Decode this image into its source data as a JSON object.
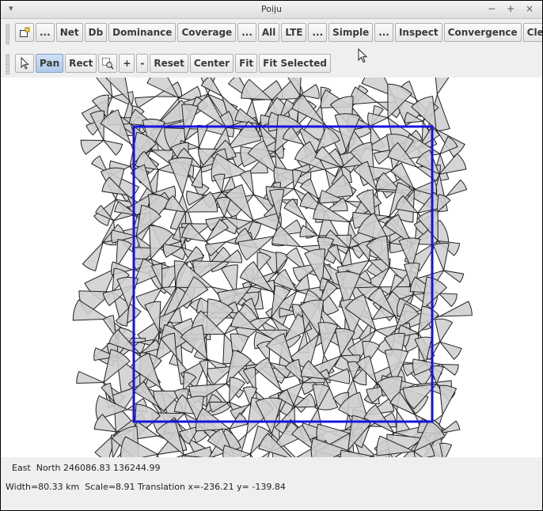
{
  "window": {
    "title": "Poiju",
    "controls": "− + ×"
  },
  "toolbar1": {
    "buttons": [
      "...",
      "Net",
      "Db",
      "Dominance",
      "Coverage",
      "...",
      "All",
      "LTE",
      "...",
      "Simple",
      "...",
      "Inspect",
      "Convergence",
      "Cle"
    ]
  },
  "toolbar2": {
    "buttons": [
      "Pan",
      "Rect",
      "+",
      "-",
      "Reset",
      "Center",
      "Fit",
      "Fit Selected"
    ],
    "selected": "Pan"
  },
  "status": {
    "line1": "East  North 246086.83 136244.99",
    "line2": "Width=80.33 km  Scale=8.91 Translation x=-236.21 y= -139.84"
  },
  "colors": {
    "sector_fill": "#cfcfcf",
    "sector_stroke": "#222222",
    "selection": "#1414e0"
  }
}
